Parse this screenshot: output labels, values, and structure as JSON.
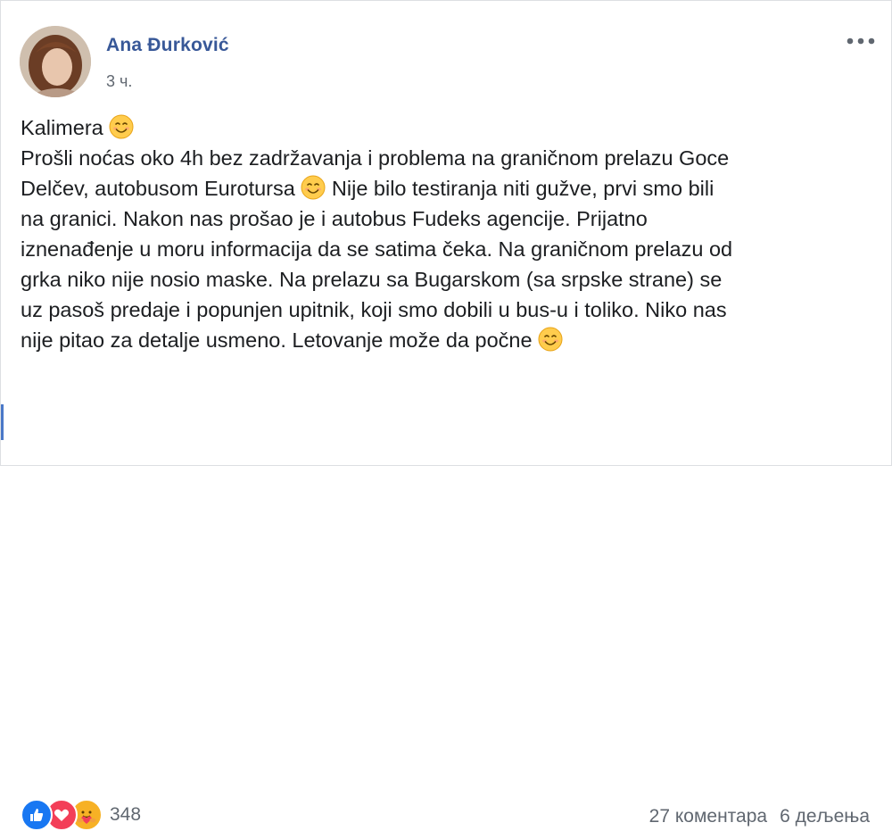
{
  "post": {
    "author": "Ana Đurković",
    "time": "3 ч.",
    "lines": [
      "Kalimera",
      "Prošli noćas oko 4h bez zadržavanja i problema na graničnom prelazu Goce",
      "Delčev, autobusom Eurotursa",
      "Nije bilo testiranja niti gužve, prvi smo bili",
      "na granici. Nakon nas prošao je i autobus Fudeks agencije. Prijatno",
      "iznenađenje u moru informacija da se satima čeka. Na graničnom prelazu od",
      "grka niko nije nosio maske. Na prelazu sa Bugarskom (sa srpske strane) se",
      "uz pasoš predaje i popunjen upitnik, koji smo dobili u bus-u i toliko. Niko nas",
      "nije pitao za detalje usmeno. Letovanje može da počne"
    ]
  },
  "footer": {
    "reaction_count": "348",
    "comments": "27 коментара",
    "shares": "6 дељења"
  },
  "icons": {
    "emoji": "smiling-face-icon",
    "more": "more-options-icon",
    "reactions": [
      "like-icon",
      "love-icon",
      "care-icon"
    ]
  },
  "colors": {
    "author": "#385898",
    "like": "#1877f2",
    "love": "#f33e58",
    "care": "#f7b125",
    "secondary_text": "#606770"
  }
}
